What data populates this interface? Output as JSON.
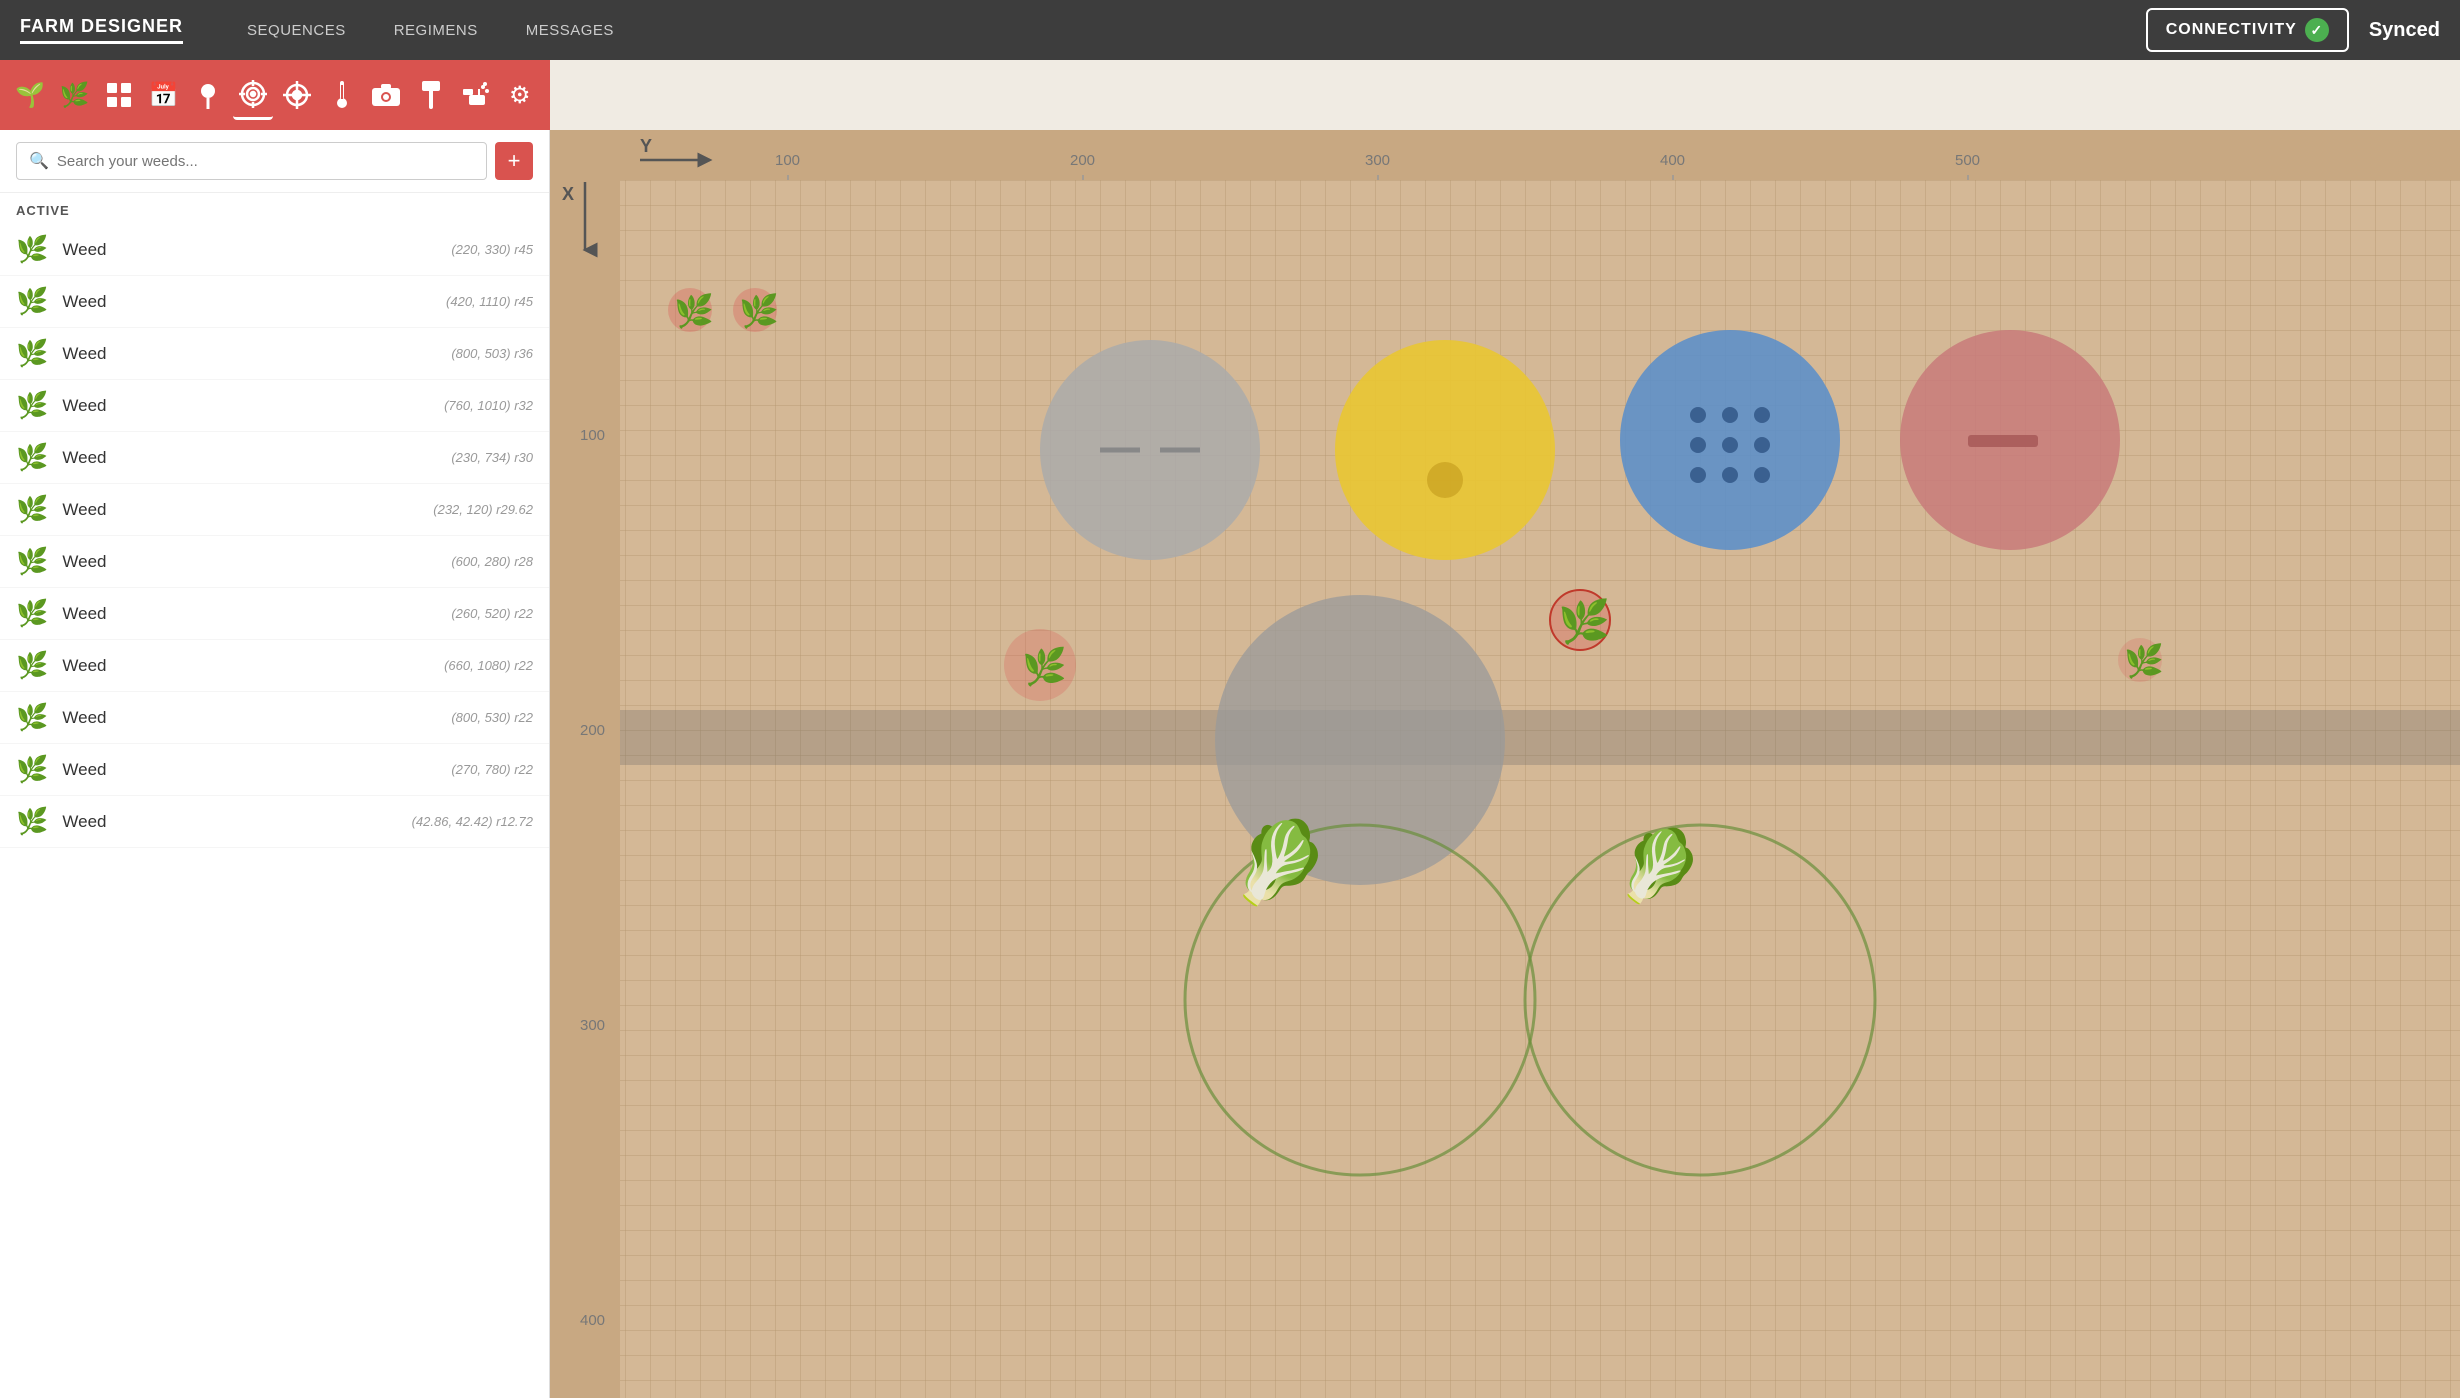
{
  "nav": {
    "brand": "FARM DESIGNER",
    "links": [
      "SEQUENCES",
      "REGIMENS",
      "MESSAGES"
    ],
    "connectivity_label": "CONNECTIVITY",
    "synced_label": "Synced"
  },
  "toolbar": {
    "icons": [
      {
        "name": "seedling-icon",
        "symbol": "🌱"
      },
      {
        "name": "plant-icon",
        "symbol": "🌿"
      },
      {
        "name": "grid-icon",
        "symbol": "⊞"
      },
      {
        "name": "calendar-icon",
        "symbol": "📅"
      },
      {
        "name": "pin-icon",
        "symbol": "📍"
      },
      {
        "name": "target-icon",
        "symbol": "⊙"
      },
      {
        "name": "crosshair-icon",
        "symbol": "⊕"
      },
      {
        "name": "thermometer-icon",
        "symbol": "🌡"
      },
      {
        "name": "camera-icon",
        "symbol": "📷"
      },
      {
        "name": "tool-icon",
        "symbol": "🔧"
      },
      {
        "name": "spray-icon",
        "symbol": "💧"
      },
      {
        "name": "settings-icon",
        "symbol": "⚙"
      }
    ]
  },
  "sidebar": {
    "search_placeholder": "Search your weeds...",
    "section_label": "ACTIVE",
    "add_button_label": "+",
    "weeds": [
      {
        "name": "Weed",
        "coords": "(220, 330) r45"
      },
      {
        "name": "Weed",
        "coords": "(420, 1110) r45"
      },
      {
        "name": "Weed",
        "coords": "(800, 503) r36"
      },
      {
        "name": "Weed",
        "coords": "(760, 1010) r32"
      },
      {
        "name": "Weed",
        "coords": "(230, 734) r30"
      },
      {
        "name": "Weed",
        "coords": "(232, 120) r29.62"
      },
      {
        "name": "Weed",
        "coords": "(600, 280) r28"
      },
      {
        "name": "Weed",
        "coords": "(260, 520) r22"
      },
      {
        "name": "Weed",
        "coords": "(660, 1080) r22"
      },
      {
        "name": "Weed",
        "coords": "(800, 530) r22"
      },
      {
        "name": "Weed",
        "coords": "(270, 780) r22"
      },
      {
        "name": "Weed",
        "coords": "(42.86, 42.42) r12.72"
      }
    ]
  },
  "map": {
    "x_label": "X",
    "y_label": "Y",
    "ruler_x": [
      100,
      200,
      300,
      400,
      500
    ],
    "ruler_y": [
      100,
      200,
      300,
      400
    ]
  }
}
